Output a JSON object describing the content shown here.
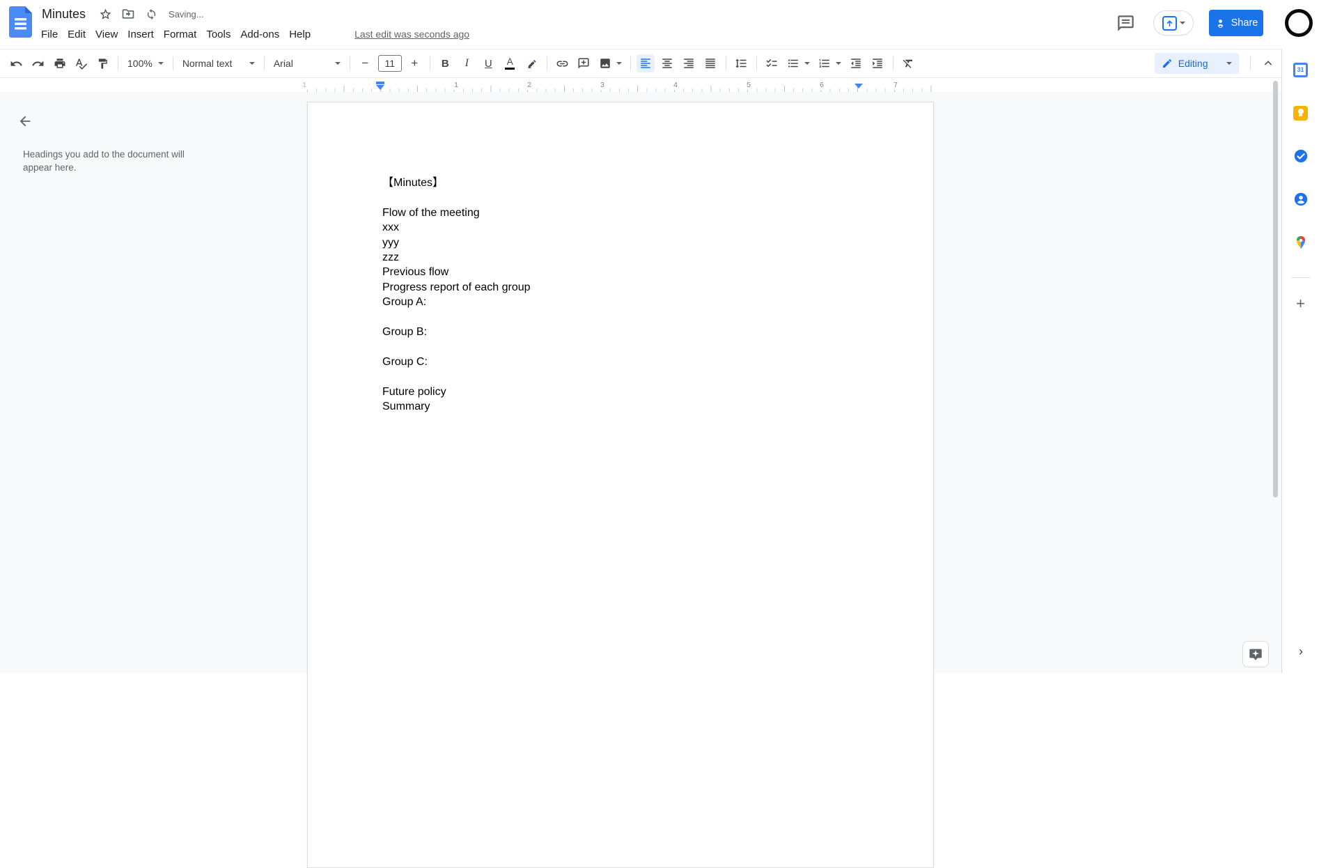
{
  "header": {
    "title": "Minutes",
    "saving": "Saving...",
    "menu_items": [
      "File",
      "Edit",
      "View",
      "Insert",
      "Format",
      "Tools",
      "Add-ons",
      "Help"
    ],
    "last_edit": "Last edit was seconds ago",
    "share_label": "Share"
  },
  "toolbar": {
    "zoom": "100%",
    "styles": "Normal text",
    "font": "Arial",
    "font_size": "11",
    "bold": "B",
    "italic": "I",
    "underline": "U",
    "text_color": "A",
    "mode": "Editing"
  },
  "outline": {
    "placeholder": "Headings you add to the document will appear here."
  },
  "ruler": {
    "numbers": [
      "1",
      "1",
      "2",
      "3",
      "4",
      "5",
      "6",
      "7"
    ]
  },
  "document": {
    "lines": [
      "【Minutes】",
      "",
      "Flow of the meeting",
      "xxx",
      "yyy",
      "zzz",
      "Previous flow",
      "Progress report of each group",
      "Group A:",
      "",
      "Group B:",
      "",
      "Group C:",
      "",
      "Future policy",
      "Summary"
    ]
  },
  "side_panel": {
    "calendar_label": "31"
  },
  "colors": {
    "accent_blue": "#1a73e8",
    "active_bg": "#e8f0fe",
    "canvas": "#f8f9fa",
    "icon_grey": "#444746"
  }
}
